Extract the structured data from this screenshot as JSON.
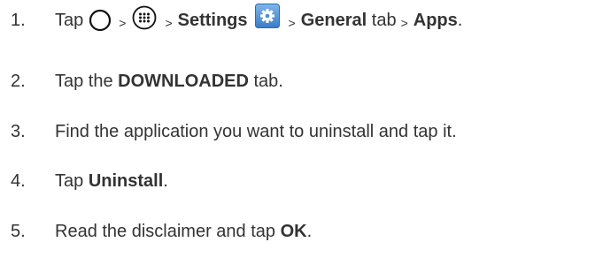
{
  "steps": [
    {
      "number": "1.",
      "parts": {
        "tap": "Tap",
        "sep1": ">",
        "sep2": ">",
        "settings": "Settings",
        "sep3": ">",
        "general": "General",
        "tab": "tab",
        "sep4": ">",
        "apps": "Apps",
        "period": "."
      },
      "icons": [
        "home-button-icon",
        "apps-launcher-icon",
        "settings-gear-icon"
      ]
    },
    {
      "number": "2.",
      "pre": "Tap the ",
      "bold": "DOWNLOADED",
      "post": " tab."
    },
    {
      "number": "3.",
      "text": "Find the application you want to uninstall and tap it."
    },
    {
      "number": "4.",
      "pre": "Tap ",
      "bold": "Uninstall",
      "post": "."
    },
    {
      "number": "5.",
      "pre": "Read the disclaimer and tap ",
      "bold": "OK",
      "post": "."
    }
  ],
  "colors": {
    "text": "#333333",
    "settings_icon_bg": "#4a8fd6"
  }
}
